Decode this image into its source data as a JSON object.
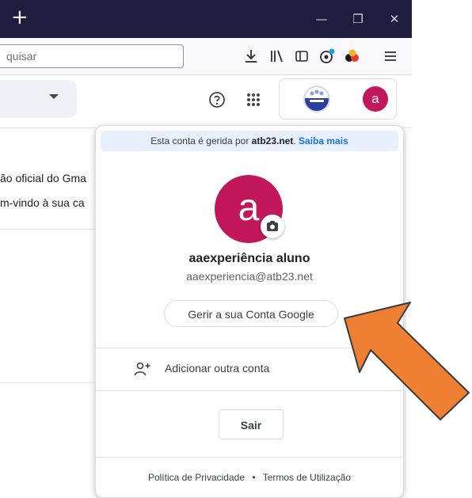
{
  "browser": {
    "new_tab_glyph": "+",
    "minimize_glyph": "—",
    "restore_glyph": "❐",
    "close_glyph": "✕",
    "search_placeholder": "quisar",
    "toolbar_icons": [
      "download-icon",
      "library-icon",
      "sidebar-icon",
      "extension-icon",
      "extension-icon-2",
      "menu-icon"
    ]
  },
  "gmail": {
    "icons": [
      "help-icon",
      "apps-grid-icon",
      "school-logo",
      "account-avatar"
    ],
    "chip_avatar_letter": "a",
    "mail_fragments": [
      "ão oficial do Gma",
      "m-vindo à sua ca"
    ]
  },
  "popup": {
    "managed_prefix": "Esta conta é gerida por ",
    "managed_domain": "atb23.net",
    "managed_sep": ". ",
    "managed_link": "Saiba mais",
    "avatar_letter": "a",
    "user_name": "aaexperiência aluno",
    "user_email": "aaexperiencia@atb23.net",
    "manage_button": "Gerir a sua Conta Google",
    "add_account": "Adicionar outra conta",
    "sign_out": "Sair",
    "privacy": "Política de Privacidade",
    "footer_sep": "•",
    "terms": "Termos de Utilização"
  },
  "colors": {
    "titlebar": "#1f1c3f",
    "avatar": "#c2185b",
    "managed_bar": "#e8f0fe",
    "link": "#1a73e8",
    "arrow": "#ee7f33"
  }
}
